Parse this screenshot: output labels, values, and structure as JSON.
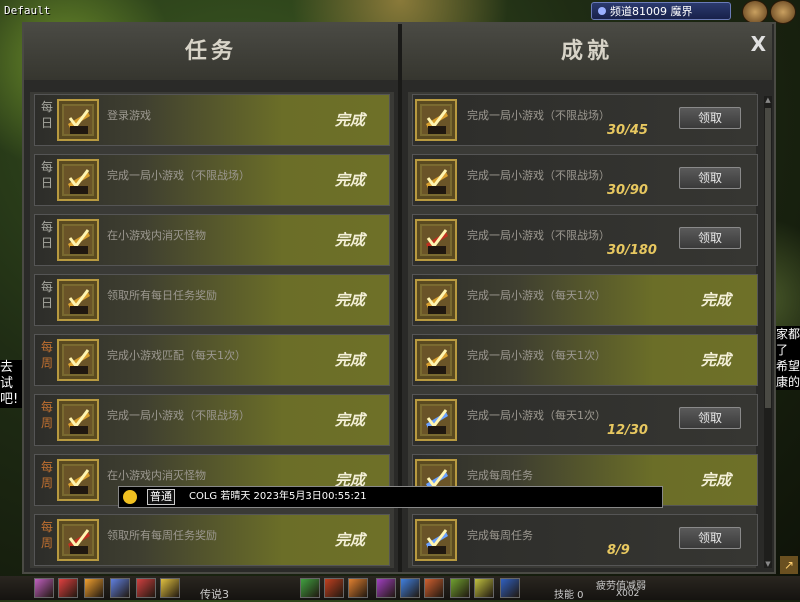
{
  "window": {
    "label": "Default"
  },
  "channel": {
    "text": "频道81009 魔界"
  },
  "panel": {
    "close_label": "X",
    "tasks_header": "任务",
    "achievements_header": "成就"
  },
  "tasks": [
    {
      "tag": "每日",
      "type": "daily",
      "title": "登录游戏",
      "status": "完成"
    },
    {
      "tag": "每日",
      "type": "daily",
      "title": "完成一局小游戏（不限战场）",
      "status": "完成"
    },
    {
      "tag": "每日",
      "type": "daily",
      "title": "在小游戏内消灭怪物",
      "status": "完成"
    },
    {
      "tag": "每日",
      "type": "daily",
      "title": "领取所有每日任务奖励",
      "status": "完成"
    },
    {
      "tag": "每周",
      "type": "weekly",
      "title": "完成小游戏匹配（每天1次）",
      "status": "完成"
    },
    {
      "tag": "每周",
      "type": "weekly",
      "title": "完成一局小游戏（不限战场）",
      "status": "完成"
    },
    {
      "tag": "每周",
      "type": "weekly",
      "title": "在小游戏内消灭怪物",
      "status": "完成"
    },
    {
      "tag": "每周",
      "type": "weekly",
      "title": "领取所有每周任务奖励",
      "status": "完成"
    }
  ],
  "achievements": [
    {
      "title": "完成一局小游戏（不限战场）",
      "progress": "30/45",
      "button": "领取",
      "done": false
    },
    {
      "title": "完成一局小游戏（不限战场）",
      "progress": "30/90",
      "button": "领取",
      "done": false
    },
    {
      "title": "完成一局小游戏（不限战场）",
      "progress": "30/180",
      "button": "领取",
      "done": false
    },
    {
      "title": "完成一局小游戏（每天1次）",
      "status": "完成",
      "done": true
    },
    {
      "title": "完成一局小游戏（每天1次）",
      "status": "完成",
      "done": true
    },
    {
      "title": "完成一局小游戏（每天1次）",
      "progress": "12/30",
      "button": "领取",
      "done": false
    },
    {
      "title": "完成每周任务",
      "status": "完成",
      "done": true
    },
    {
      "title": "完成每周任务",
      "progress": "8/9",
      "button": "领取",
      "done": false
    }
  ],
  "icon_badge": "活动",
  "chat": {
    "channel": "普通",
    "message": "COLG 若晴天 2023年5月3日00:55:21"
  },
  "side_text_left": "去试 吧!",
  "side_text_right": "家都 了 希望 康的",
  "bottom": {
    "hotkey_label": "传说3",
    "skill_label": "技能 0",
    "status_label": "疲劳值减弱",
    "count_label": "X002"
  },
  "colors": {
    "done_row": "#6e7028",
    "pending_row": "#363632",
    "weekly_tag": "#c07030",
    "progress_text": "#e8c860"
  }
}
